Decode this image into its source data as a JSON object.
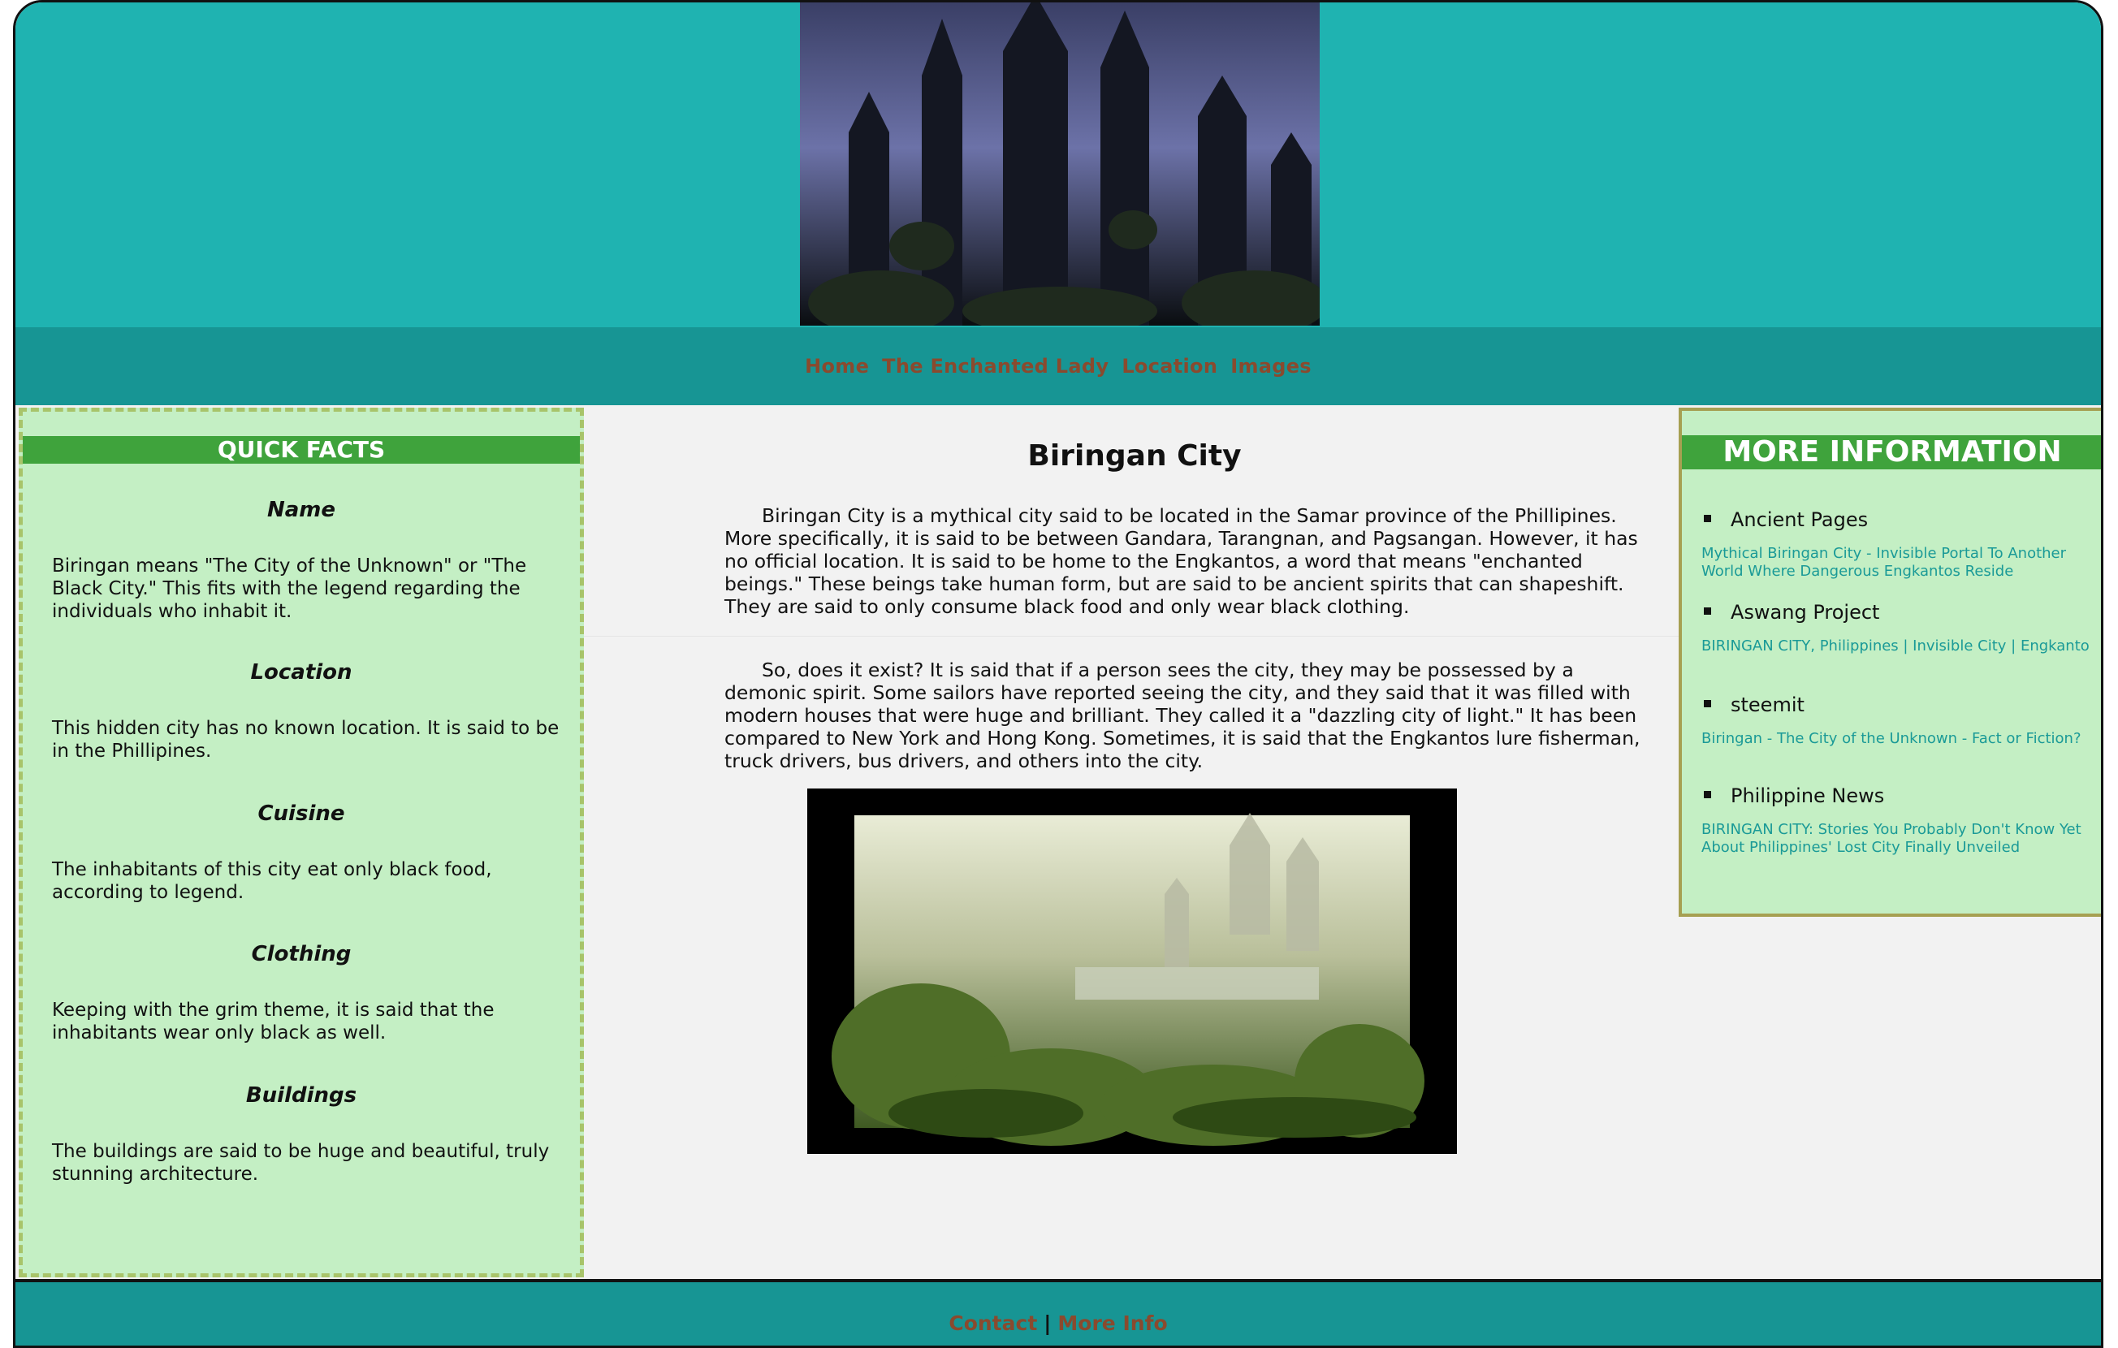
{
  "nav": {
    "items": [
      "Home",
      "The Enchanted Lady",
      "Location",
      "Images"
    ]
  },
  "quick_facts": {
    "title": "QUICK FACTS",
    "facts": [
      {
        "heading": "Name",
        "text": "Biringan means \"The City of the Unknown\" or \"The Black City.\" This fits with the legend regarding the individuals who inhabit it."
      },
      {
        "heading": "Location",
        "text": "This hidden city has no known location. It is said to be in the Phillipines."
      },
      {
        "heading": "Cuisine",
        "text": "The inhabitants of this city eat only black food, according to legend."
      },
      {
        "heading": "Clothing",
        "text": "Keeping with the grim theme, it is said that the inhabitants wear only black as well."
      },
      {
        "heading": "Buildings",
        "text": "The buildings are said to be huge and beautiful, truly stunning architecture."
      }
    ]
  },
  "main": {
    "title": "Biringan City",
    "paragraphs": [
      "Biringan City is a mythical city said to be located in the Samar province of the Phillipines. More specifically, it is said to be between Gandara, Tarangnan, and Pagsangan. However, it has no official location. It is said to be home to the Engkantos, a word that means \"enchanted beings.\" These beings take human form, but are said to be ancient spirits that can shapeshift. They are said to only consume black food and only wear black clothing.",
      "So, does it exist? It is said that if a person sees the city, they may be possessed by a demonic spirit. Some sailors have reported seeing the city, and they said that it was filled with modern houses that were huge and brilliant. They called it a \"dazzling city of light.\" It has been compared to New York and Hong Kong. Sometimes, it is said that the Engkantos lure fisherman, truck drivers, bus drivers, and others into the city."
    ]
  },
  "more_info": {
    "title": "MORE INFORMATION",
    "sources": [
      {
        "name": "Ancient Pages",
        "link": "Mythical Biringan City - Invisible Portal To Another World Where Dangerous Engkantos Reside"
      },
      {
        "name": "Aswang Project",
        "link": "BIRINGAN CITY, Philippines | Invisible City | Engkanto"
      },
      {
        "name": "steemit",
        "link": "Biringan - The City of the Unknown - Fact or Fiction?"
      },
      {
        "name": "Philippine News",
        "link": "BIRINGAN CITY: Stories You Probably Don't Know Yet About Philippines' Lost City Finally Unveiled"
      }
    ]
  },
  "footer": {
    "contact": "Contact",
    "separator": "|",
    "more": "More Info"
  },
  "colors": {
    "header": "#1fb3b1",
    "nav": "#179594",
    "panel": "#c4efc4",
    "panel_title": "#3fa33c",
    "link": "#8a4a2e",
    "side_link": "#1a9a97"
  }
}
